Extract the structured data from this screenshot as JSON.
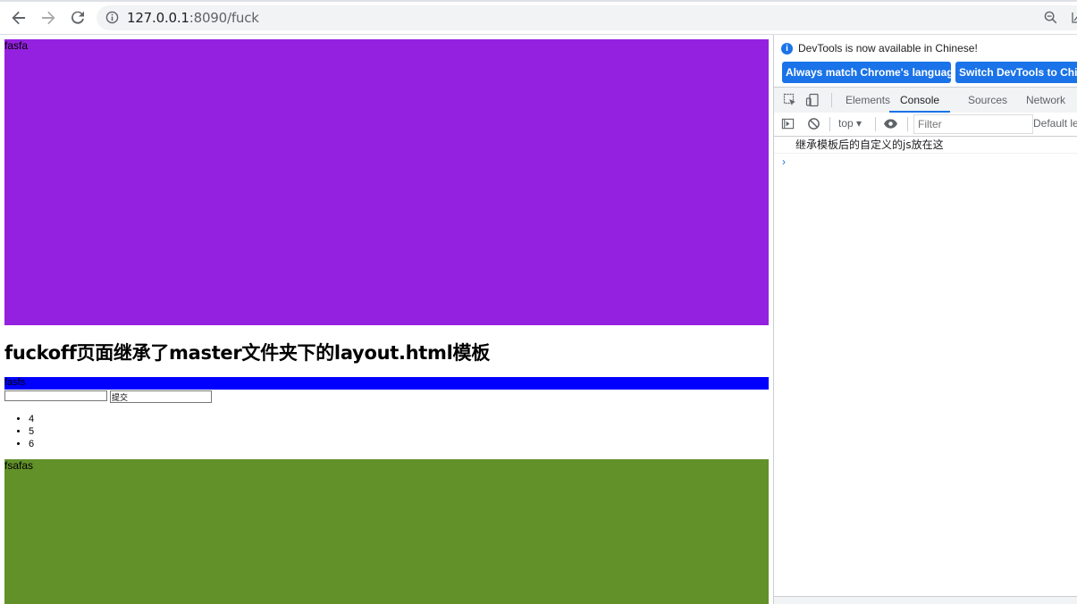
{
  "browser": {
    "url_host": "127.0.0.1",
    "url_rest": ":8090/fuck"
  },
  "page": {
    "purple_box_text": "fasfa",
    "heading": "fuckoff页面继承了master文件夹下的layout.html模板",
    "blue_box_text": "fasfs",
    "form": {
      "text_value": "",
      "submit_label": "提交"
    },
    "list_items": [
      "4",
      "5",
      "6"
    ],
    "green_box_text": "fsafas",
    "colors": {
      "purple": "#9421e0",
      "blue": "#0000ff",
      "green": "#62912a"
    }
  },
  "devtools": {
    "notice": "DevTools is now available in Chinese!",
    "btn_match_language": "Always match Chrome's language",
    "btn_switch": "Switch DevTools to Chinese",
    "tabs": [
      "Elements",
      "Console",
      "Sources",
      "Network"
    ],
    "active_tab": "Console",
    "context": "top",
    "filter_placeholder": "Filter",
    "levels": "Default levels",
    "console_message": "继承模板后的自定义的js放在这",
    "prompt": "›"
  }
}
